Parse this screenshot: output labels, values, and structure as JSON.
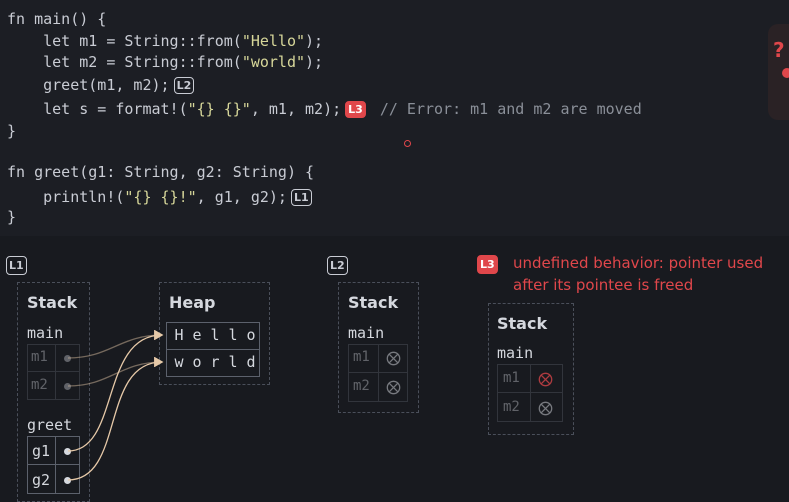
{
  "code": {
    "line1": "fn main() {",
    "line2_pre": "    let m1 = String::from(",
    "line2_str": "\"Hello\"",
    "line2_post": ");",
    "line3_pre": "    let m2 = String::from(",
    "line3_str": "\"world\"",
    "line3_post": ");",
    "line4": "    greet(m1, m2);",
    "line4_marker": "L2",
    "line5_pre": "    let s = format!(",
    "line5_str": "\"{} {}\"",
    "line5_post": ", m1, m2);",
    "line5_marker": "L3",
    "line5_comment": "// Error: m1 and m2 are moved",
    "line6": "}",
    "line8": "fn greet(g1: String, g2: String) {",
    "line9_pre": "    println!(",
    "line9_str": "\"{} {}!\"",
    "line9_post": ", g1, g2);",
    "line9_marker": "L1",
    "line10": "}"
  },
  "diagram": {
    "l1": {
      "label": "L1",
      "stack_title": "Stack",
      "heap_title": "Heap",
      "main_frame": "main",
      "greet_frame": "greet",
      "vars_main": [
        "m1",
        "m2"
      ],
      "vars_greet": [
        "g1",
        "g2"
      ],
      "heap_row1": [
        "H",
        "e",
        "l",
        "l",
        "o"
      ],
      "heap_row2": [
        "w",
        "o",
        "r",
        "l",
        "d"
      ]
    },
    "l2": {
      "label": "L2",
      "stack_title": "Stack",
      "main_frame": "main",
      "vars": [
        "m1",
        "m2"
      ]
    },
    "l3": {
      "label": "L3",
      "message_line1": "undefined behavior: pointer used",
      "message_line2": "after its pointee is freed",
      "stack_title": "Stack",
      "main_frame": "main",
      "vars": [
        "m1",
        "m2"
      ]
    }
  },
  "colors": {
    "background": "#181a1f",
    "code_background": "#1c1e24",
    "error_red": "#e0474b",
    "string_yellow": "#d7d79a",
    "arrow": "#e6c9a8"
  }
}
